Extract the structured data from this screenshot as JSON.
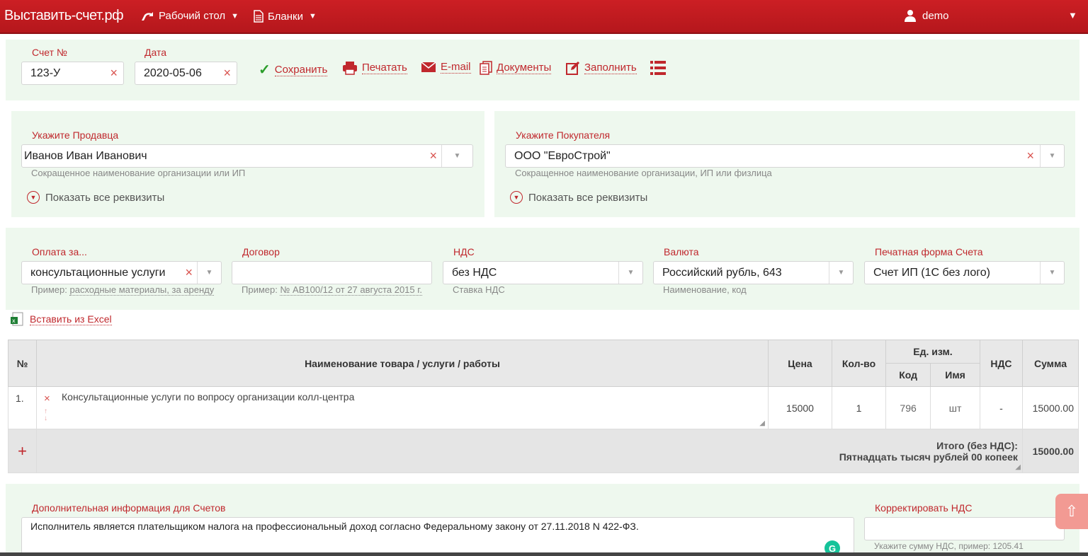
{
  "header": {
    "brand": "Выставить-счет.рф",
    "nav": [
      {
        "label": "Рабочий стол",
        "icon": "desk-icon"
      },
      {
        "label": "Бланки",
        "icon": "document-icon"
      }
    ],
    "user": "demo"
  },
  "toolbar": {
    "invoice_no_label": "Счет №",
    "invoice_no_value": "123-У",
    "date_label": "Дата",
    "date_value": "2020-05-06",
    "actions": {
      "save": "Сохранить",
      "print": "Печатать",
      "email": "E-mail",
      "documents": "Документы",
      "fill": "Заполнить"
    }
  },
  "seller": {
    "label": "Укажите Продавца",
    "value": "Иванов Иван Иванович",
    "hint": "Сокращенное наименование организации или ИП",
    "show_details": "Показать все реквизиты"
  },
  "buyer": {
    "label": "Укажите Покупателя",
    "value": "ООО \"ЕвроСтрой\"",
    "hint": "Сокращенное наименование организации, ИП или физлица",
    "show_details": "Показать все реквизиты"
  },
  "params": {
    "payment": {
      "label": "Оплата за...",
      "value": "консультационные услуги",
      "hint_prefix": "Пример:",
      "hint_examples": "расходные материалы, за аренду"
    },
    "contract": {
      "label": "Договор",
      "value": "",
      "hint_prefix": "Пример:",
      "hint_example": "№ АВ100/12 от 27 августа 2015 г."
    },
    "vat": {
      "label": "НДС",
      "value": "без НДС",
      "hint": "Ставка НДС"
    },
    "currency": {
      "label": "Валюта",
      "value": "Российский рубль, 643",
      "hint": "Наименование, код"
    },
    "print_form": {
      "label": "Печатная форма Счета",
      "value": "Счет ИП (1С без лого)"
    }
  },
  "excel_link": "Вставить из Excel",
  "table": {
    "headers": {
      "num": "№",
      "name": "Наименование товара / услуги / работы",
      "price": "Цена",
      "qty": "Кол-во",
      "unit": "Ед. изм.",
      "unit_code": "Код",
      "unit_name": "Имя",
      "vat": "НДС",
      "sum": "Сумма"
    },
    "rows": [
      {
        "num": "1.",
        "name": "Консультационные услуги по вопросу организации колл-центра",
        "price": "15000",
        "qty": "1",
        "code": "796",
        "unit": "шт",
        "vat": "-",
        "sum": "15000.00"
      }
    ],
    "total_label": "Итого (без НДС):",
    "total_words": "Пятнадцать тысяч рублей 00 копеек",
    "total_value": "15000.00"
  },
  "additional": {
    "label": "Дополнительная информация для Счетов",
    "value": "Исполнитель является плательщиком налога на профессиональный доход согласно Федеральному закону от 27.11.2018 N 422-ФЗ."
  },
  "vat_correction": {
    "label": "Корректировать НДС",
    "hint": "Укажите сумму НДС, пример: 1205.41"
  },
  "colors": {
    "brand_red": "#c0282d",
    "panel_green": "#eef8ee"
  }
}
